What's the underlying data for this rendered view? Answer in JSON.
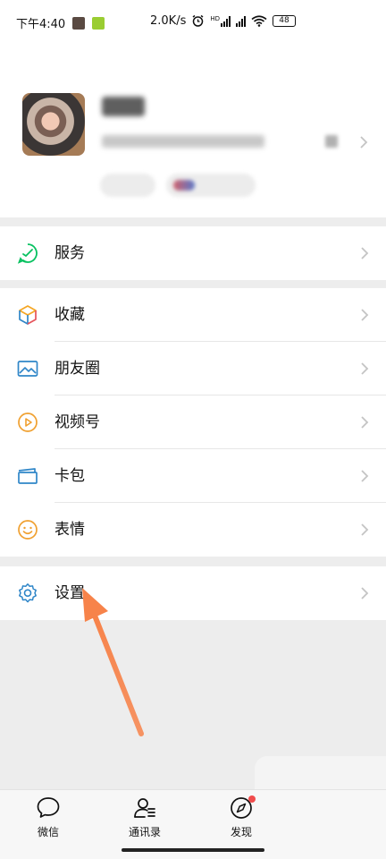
{
  "status_bar": {
    "time": "下午4:40",
    "network_speed": "2.0K/s",
    "hd_badge": "HD",
    "battery": "48"
  },
  "menu": {
    "group1": [
      {
        "label": "服务",
        "icon": "service-icon",
        "color": "#07c160"
      }
    ],
    "group2": [
      {
        "label": "收藏",
        "icon": "favorites-cube-icon",
        "color": "#f5a623"
      },
      {
        "label": "朋友圈",
        "icon": "moments-photo-icon",
        "color": "#2f86c8"
      },
      {
        "label": "视频号",
        "icon": "channels-play-icon",
        "color": "#f0a030"
      },
      {
        "label": "卡包",
        "icon": "card-wallet-icon",
        "color": "#2f86c8"
      },
      {
        "label": "表情",
        "icon": "emoji-smile-icon",
        "color": "#f0a030"
      }
    ],
    "group3": [
      {
        "label": "设置",
        "icon": "settings-gear-icon",
        "color": "#2f86c8"
      }
    ]
  },
  "tabbar": {
    "tabs": [
      {
        "label": "微信",
        "icon": "chat-bubble-icon"
      },
      {
        "label": "通讯录",
        "icon": "contacts-icon"
      },
      {
        "label": "发现",
        "icon": "compass-icon",
        "has_dot": true
      }
    ]
  },
  "annotation": {
    "arrow_color": "#f7834a"
  }
}
